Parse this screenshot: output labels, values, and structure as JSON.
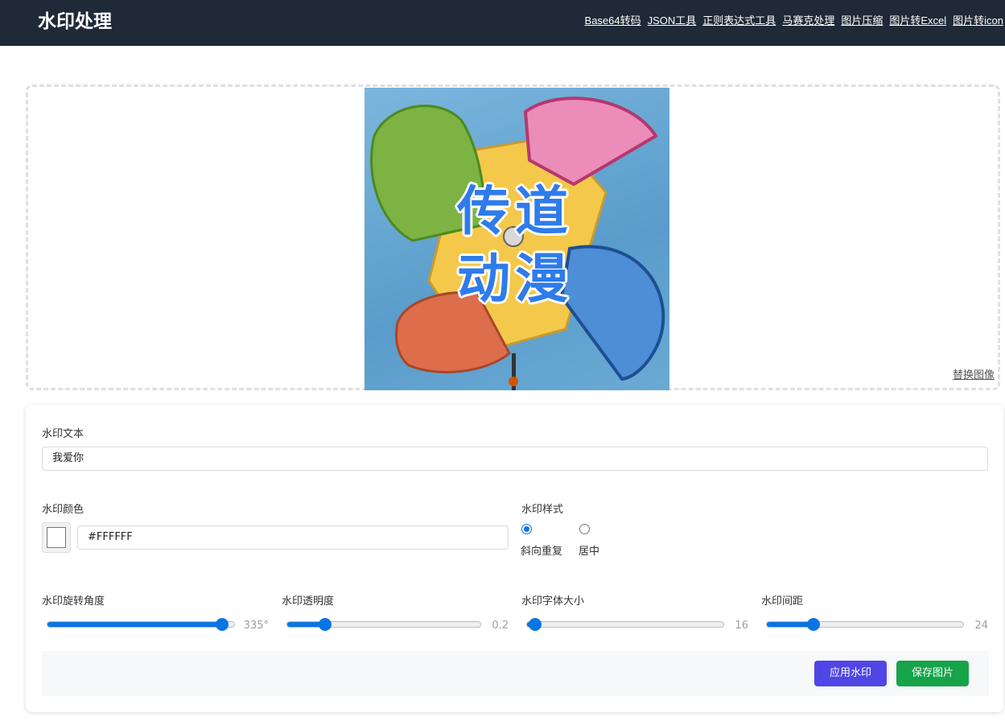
{
  "header": {
    "title": "水印处理",
    "nav": [
      "Base64转码",
      "JSON工具",
      "正则表达式工具",
      "马赛克处理",
      "图片压缩",
      "图片转Excel",
      "图片转icon"
    ]
  },
  "preview": {
    "watermark_overlay": "传道动漫",
    "replace_label": "替换图像"
  },
  "form": {
    "text_label": "水印文本",
    "text_value": "我爱你",
    "color_label": "水印颜色",
    "color_value": "#FFFFFF",
    "style_label": "水印样式",
    "style_options": [
      "斜向重复",
      "居中"
    ],
    "style_selected": "斜向重复",
    "sliders": [
      {
        "label": "水印旋转角度",
        "value": 335,
        "display": "335°",
        "min": 0,
        "max": 360
      },
      {
        "label": "水印透明度",
        "value": 0.2,
        "display": "0.2",
        "min": 0,
        "max": 1
      },
      {
        "label": "水印字体大小",
        "value": 16,
        "display": "16",
        "min": 12,
        "max": 100
      },
      {
        "label": "水印间距",
        "value": 24,
        "display": "24",
        "min": 0,
        "max": 100
      }
    ]
  },
  "actions": {
    "apply_label": "应用水印",
    "save_label": "保存图片"
  },
  "colors": {
    "header_bg": "#1f2937",
    "accent": "#0b74e5",
    "apply_button": "#4f46e5",
    "save_button": "#16a34a"
  }
}
